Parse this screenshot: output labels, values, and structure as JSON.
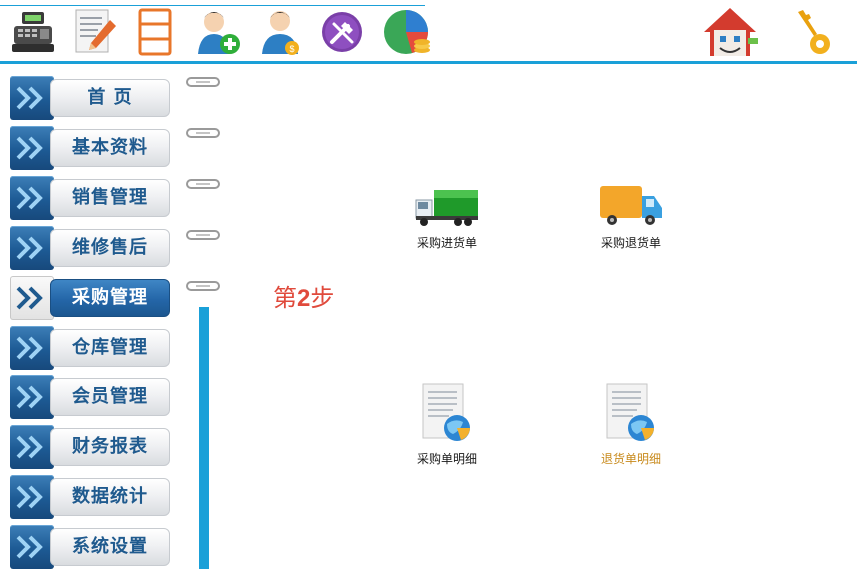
{
  "menu": {
    "items": [
      {
        "label": "首 页",
        "active": false
      },
      {
        "label": "基本资料",
        "active": false
      },
      {
        "label": "销售管理",
        "active": false
      },
      {
        "label": "维修售后",
        "active": false
      },
      {
        "label": "采购管理",
        "active": true
      },
      {
        "label": "仓库管理",
        "active": false
      },
      {
        "label": "会员管理",
        "active": false
      },
      {
        "label": "财务报表",
        "active": false
      },
      {
        "label": "数据统计",
        "active": false
      },
      {
        "label": "系统设置",
        "active": false
      }
    ]
  },
  "toolbar": {
    "icons": [
      "cash-register-icon",
      "edit-document-icon",
      "archive-icon",
      "add-user-icon",
      "user-money-icon",
      "tools-icon",
      "pie-chart-icon",
      "home-icon",
      "key-icon"
    ]
  },
  "content": {
    "step_prefix": "第",
    "step_number": "2",
    "step_suffix": "步",
    "tiles": [
      {
        "label": "采购进货单",
        "icon": "green-truck-icon"
      },
      {
        "label": "采购退货单",
        "icon": "orange-truck-icon"
      },
      {
        "label": "采购单明细",
        "icon": "document-globe-icon"
      },
      {
        "label": "退货单明细",
        "icon": "document-globe-icon"
      }
    ]
  },
  "colors": {
    "accent_blue": "#1aa0d8",
    "menu_text": "#1f5a8e",
    "step_red": "#e04a3c",
    "highlight_caption": "#c88a1c"
  }
}
